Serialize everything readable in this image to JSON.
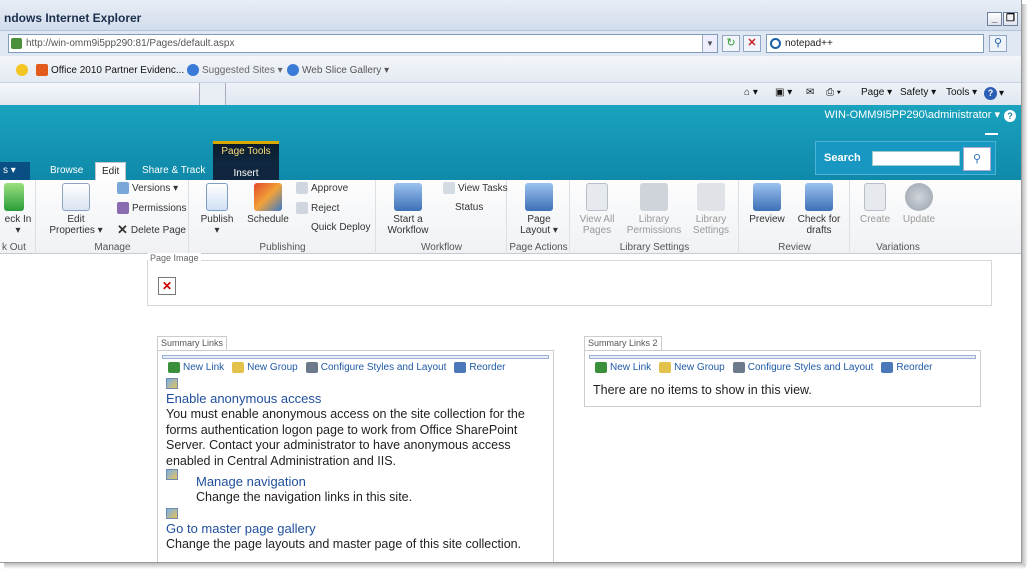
{
  "browser": {
    "title": "ndows Internet Explorer",
    "window_buttons": [
      "_",
      "❐"
    ],
    "address": "http://win-omm9i5pp290:81/Pages/default.aspx",
    "search_value": "notepad++",
    "favorites": [
      "Office 2010 Partner Evidenc...",
      "Suggested Sites ▾",
      "Web Slice Gallery ▾"
    ],
    "commands": {
      "page": "Page ▾",
      "safety": "Safety ▾",
      "tools": "Tools ▾"
    }
  },
  "sp": {
    "user": "WIN-OMM9I5PP290\\administrator ▾",
    "site_actions": "s ▾",
    "tabs": {
      "browse": "Browse",
      "edit": "Edit",
      "share": "Share & Track",
      "insert": "Insert"
    },
    "page_tools": "Page Tools",
    "search_label": "Search"
  },
  "ribbon": {
    "checkin": {
      "label_line1": "eck In",
      "label_line2": "▾",
      "group": "k Out"
    },
    "manage": {
      "edit_props_1": "Edit",
      "edit_props_2": "Properties ▾",
      "versions": "Versions ▾",
      "permissions": "Permissions",
      "delete": "Delete Page",
      "group": "Manage"
    },
    "publishing": {
      "publish": "Publish",
      "publish_arrow": "▾",
      "schedule": "Schedule",
      "approve": "Approve",
      "reject": "Reject",
      "quick_deploy": "Quick Deploy",
      "group": "Publishing"
    },
    "workflow": {
      "start_1": "Start a",
      "start_2": "Workflow",
      "view_tasks": "View Tasks",
      "status": "Status",
      "group": "Workflow"
    },
    "page_actions": {
      "layout_1": "Page",
      "layout_2": "Layout ▾",
      "group": "Page Actions"
    },
    "library": {
      "view_all_1": "View All",
      "view_all_2": "Pages",
      "perms_1": "Library",
      "perms_2": "Permissions",
      "settings_1": "Library",
      "settings_2": "Settings",
      "group": "Library Settings"
    },
    "review": {
      "preview": "Preview",
      "check_1": "Check for",
      "check_2": "drafts",
      "group": "Review"
    },
    "variations": {
      "create": "Create",
      "update": "Update",
      "group": "Variations"
    }
  },
  "content": {
    "page_image_tag": "Page Image",
    "zone1": {
      "title": "Summary Links",
      "toolbar": [
        "New Link",
        "New Group",
        "Configure Styles and Layout",
        "Reorder"
      ],
      "items": [
        {
          "title": "Enable anonymous access",
          "desc": "You must enable anonymous access on the site collection for the forms authentication logon page to work from Office SharePoint Server. Contact your administrator to have anonymous access enabled in Central Administration and IIS."
        },
        {
          "title": "Manage navigation",
          "desc": "Change the navigation links in this site."
        },
        {
          "title": "Go to master page gallery",
          "desc": "Change the page layouts and master page of this site collection."
        }
      ]
    },
    "zone2": {
      "title": "Summary Links 2",
      "toolbar": [
        "New Link",
        "New Group",
        "Configure Styles and Layout",
        "Reorder"
      ],
      "empty": "There are no items to show in this view."
    }
  }
}
